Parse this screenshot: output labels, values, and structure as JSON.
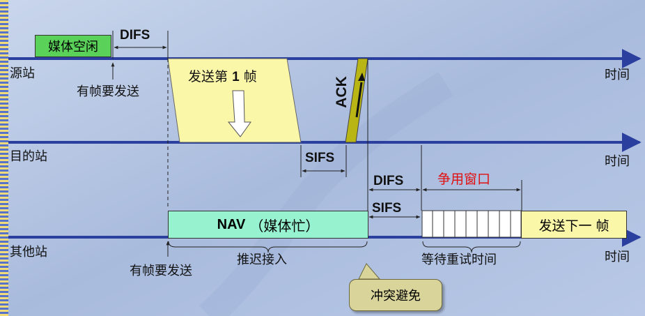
{
  "rows": {
    "source": "源站",
    "destination": "目的站",
    "other": "其他站"
  },
  "time_label": "时间",
  "source_row": {
    "medium_idle": "媒体空闲",
    "difs": "DIFS",
    "frame_to_send": "有帧要发送",
    "send_frame_1": "发送第",
    "frame_number": "1",
    "frame_unit": "帧"
  },
  "destination_row": {
    "ack": "ACK",
    "sifs": "SIFS"
  },
  "other_row": {
    "difs": "DIFS",
    "sifs": "SIFS",
    "contention_window": "争用窗口",
    "nav": "NAV",
    "nav_note": "（媒体忙）",
    "send_next_frame": "发送下一 帧",
    "frame_to_send": "有帧要发送",
    "deferred_access": "推迟接入",
    "backoff_time": "等待重试时间",
    "collision_avoidance": "冲突避免"
  },
  "colors": {
    "axis_blue": "#2b3f9e",
    "idle_green": "#5ad25a",
    "frame_yellow": "#fbf7a8",
    "ack_olive": "#b9b515",
    "nav_teal": "#97f2cf",
    "contention_red": "#e01010",
    "callout_khaki": "#d8d49a"
  }
}
